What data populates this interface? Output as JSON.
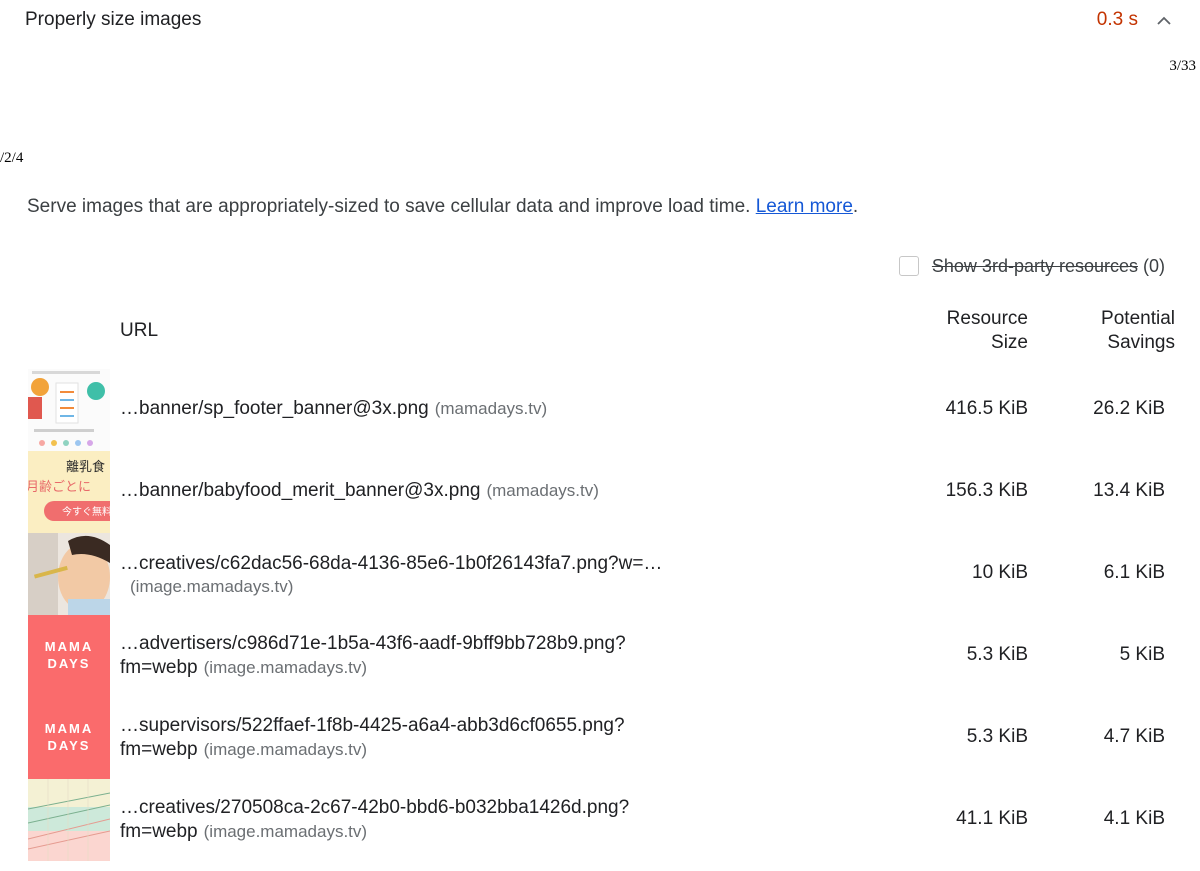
{
  "audit": {
    "title": "Properly size images",
    "metric": "0.3 s",
    "page_counter_right": "3/33",
    "page_counter_left": "/2/4",
    "description": "Serve images that are appropriately-sized to save cellular data and improve load time. ",
    "learn_more": "Learn more",
    "description_end": ".",
    "third_party_label": "Show 3rd-party resources",
    "third_party_count": "(0)",
    "metric_color": "#c33300",
    "link_color": "#1558d6"
  },
  "table": {
    "headers": {
      "url": "URL",
      "size_1": "Resource",
      "size_2": "Size",
      "savings_1": "Potential",
      "savings_2": "Savings"
    },
    "rows": [
      {
        "url": "…banner/sp_footer_banner@3x.png",
        "url_2": "",
        "host": "(mamadays.tv)",
        "size": "416.5 KiB",
        "savings": "26.2 KiB",
        "thumb": "footer-banner-thumbnail",
        "thumb_text": ""
      },
      {
        "url": "…banner/babyfood_merit_banner@3x.png",
        "url_2": "",
        "host": "(mamadays.tv)",
        "size": "156.3 KiB",
        "savings": "13.4 KiB",
        "thumb": "babyfood-banner-thumbnail",
        "thumb_text": "離乳食|月齢ごとに|今すぐ無料"
      },
      {
        "url": "…creatives/c62dac56-68da-4136-85e6-1b0f26143fa7.png?w=…",
        "url_2": "",
        "host": "(image.mamadays.tv)",
        "size": "10 KiB",
        "savings": "6.1 KiB",
        "thumb": "baby-photo-thumbnail",
        "thumb_text": ""
      },
      {
        "url": "…advertisers/c986d71e-1b5a-43f6-aadf-9bff9bb728b9.png?",
        "url_2": "fm=webp",
        "host": "(image.mamadays.tv)",
        "size": "5.3 KiB",
        "savings": "5 KiB",
        "thumb": "mamadays-logo-thumbnail",
        "thumb_text": "MAMA|DAYS"
      },
      {
        "url": "…supervisors/522ffaef-1f8b-4425-a6a4-abb3d6cf0655.png?",
        "url_2": "fm=webp",
        "host": "(image.mamadays.tv)",
        "size": "5.3 KiB",
        "savings": "4.7 KiB",
        "thumb": "mamadays-logo-thumbnail",
        "thumb_text": "MAMA|DAYS"
      },
      {
        "url": "…creatives/270508ca-2c67-42b0-bbd6-b032bba1426d.png?",
        "url_2": "fm=webp",
        "host": "(image.mamadays.tv)",
        "size": "41.1 KiB",
        "savings": "4.1 KiB",
        "thumb": "growth-chart-thumbnail",
        "thumb_text": ""
      }
    ]
  }
}
